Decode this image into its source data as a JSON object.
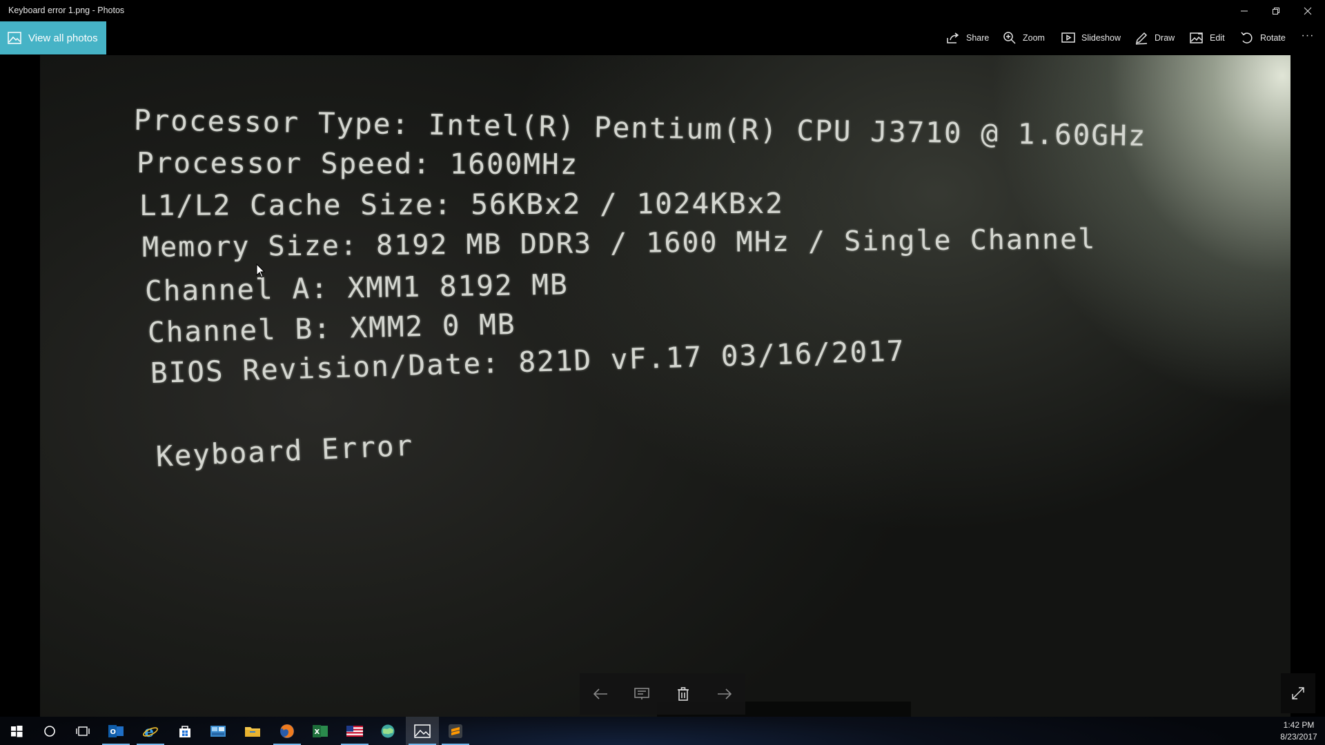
{
  "window": {
    "title": "Keyboard error 1.png - Photos",
    "controls": {
      "minimize": "minimize",
      "restore": "restore",
      "close": "close"
    }
  },
  "toolbar": {
    "view_all": "View all photos",
    "items": [
      {
        "label": "Share",
        "icon": "share-icon"
      },
      {
        "label": "Zoom",
        "icon": "zoom-icon"
      },
      {
        "label": "Slideshow",
        "icon": "slideshow-icon"
      },
      {
        "label": "Draw",
        "icon": "draw-icon"
      },
      {
        "label": "Edit",
        "icon": "edit-icon"
      },
      {
        "label": "Rotate",
        "icon": "rotate-icon"
      }
    ],
    "more": "···"
  },
  "photo": {
    "lines": {
      "processor_type": "Processor Type: Intel(R) Pentium(R) CPU J3710 @ 1.60GHz",
      "processor_speed": "Processor Speed: 1600MHz",
      "cache_size": "L1/L2 Cache Size: 56KBx2 / 1024KBx2",
      "memory_size": "Memory Size: 8192 MB DDR3 / 1600 MHz / Single Channel",
      "channel_a": "Channel A: XMM1 8192 MB",
      "channel_b": "Channel B: XMM2 0 MB",
      "bios_revision": "BIOS Revision/Date: 821D vF.17 03/16/2017",
      "keyboard_error": "Keyboard Error"
    }
  },
  "controls": {
    "previous": "arrow-left-icon",
    "slideshow": "slideshow-icon",
    "delete": "trash-icon",
    "next": "arrow-right-icon",
    "fullscreen": "expand-icon"
  },
  "taskbar": {
    "apps": [
      "start",
      "search",
      "task-view",
      "outlook",
      "internet-explorer",
      "store",
      "control-panel",
      "file-explorer",
      "firefox",
      "excel",
      "flag-app",
      "globe-app",
      "photos",
      "sublime"
    ],
    "time": "1:42 PM",
    "date": "8/23/2017"
  },
  "colors": {
    "accent": "#46b3c6",
    "taskbar_highlight": "#76b9ed",
    "screen_text": "#d4d6d0"
  }
}
